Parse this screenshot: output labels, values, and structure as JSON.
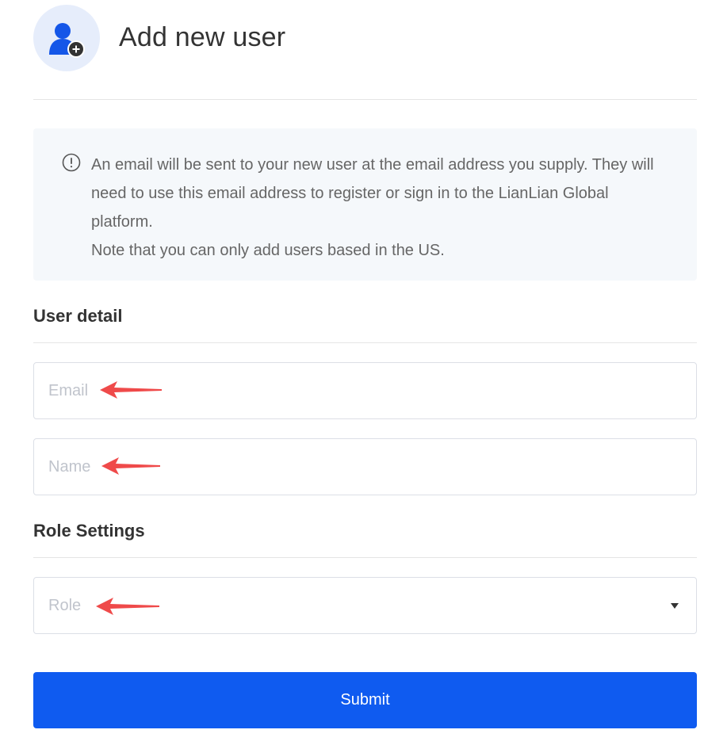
{
  "header": {
    "title": "Add new user",
    "icon": "add-user-icon"
  },
  "notice": {
    "icon": "info-icon",
    "lines": [
      "An email will be sent to your new user at the email address you supply. They will need to use this email address to register or sign in to the LianLian Global platform.",
      "Note that you can only add users based in the US."
    ]
  },
  "user_detail": {
    "title": "User detail",
    "email_placeholder": "Email",
    "email_value": "",
    "name_placeholder": "Name",
    "name_value": ""
  },
  "role_settings": {
    "title": "Role Settings",
    "role_placeholder": "Role",
    "role_value": ""
  },
  "submit_label": "Submit",
  "colors": {
    "primary": "#0f5bf0",
    "annotation_arrow": "#ef4a4a",
    "notice_bg": "#f5f8fb",
    "avatar_bg": "#e6edfb"
  }
}
